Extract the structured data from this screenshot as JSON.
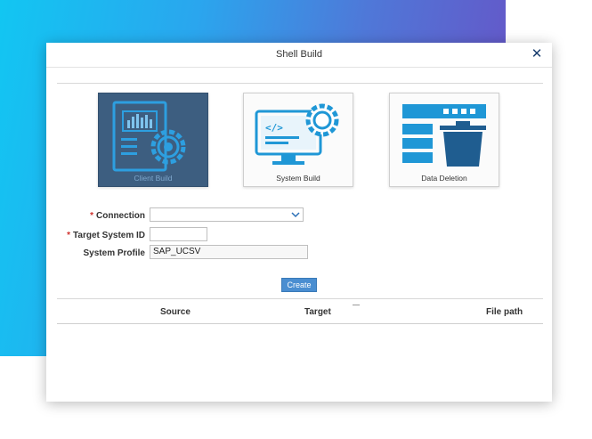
{
  "dialog": {
    "title": "Shell Build",
    "close_glyph": "✕"
  },
  "tiles": [
    {
      "label": "Client Build",
      "icon": "client-build-icon",
      "selected": true
    },
    {
      "label": "System Build",
      "icon": "system-build-icon",
      "selected": false
    },
    {
      "label": "Data Deletion",
      "icon": "data-deletion-icon",
      "selected": false
    }
  ],
  "form": {
    "required_marker": "*",
    "connection": {
      "label": "Connection",
      "value": ""
    },
    "target_system_id": {
      "label": "Target System ID",
      "value": ""
    },
    "system_profile": {
      "label": "System Profile",
      "value": "SAP_UCSV"
    },
    "create_label": "Create"
  },
  "table": {
    "columns": [
      "Source",
      "Target",
      "File path"
    ],
    "rows": []
  },
  "colors": {
    "accent": "#4a8ed1",
    "selected_tile": "#3d5e80",
    "icon_blue": "#1f97d6",
    "required": "#d0312d"
  }
}
